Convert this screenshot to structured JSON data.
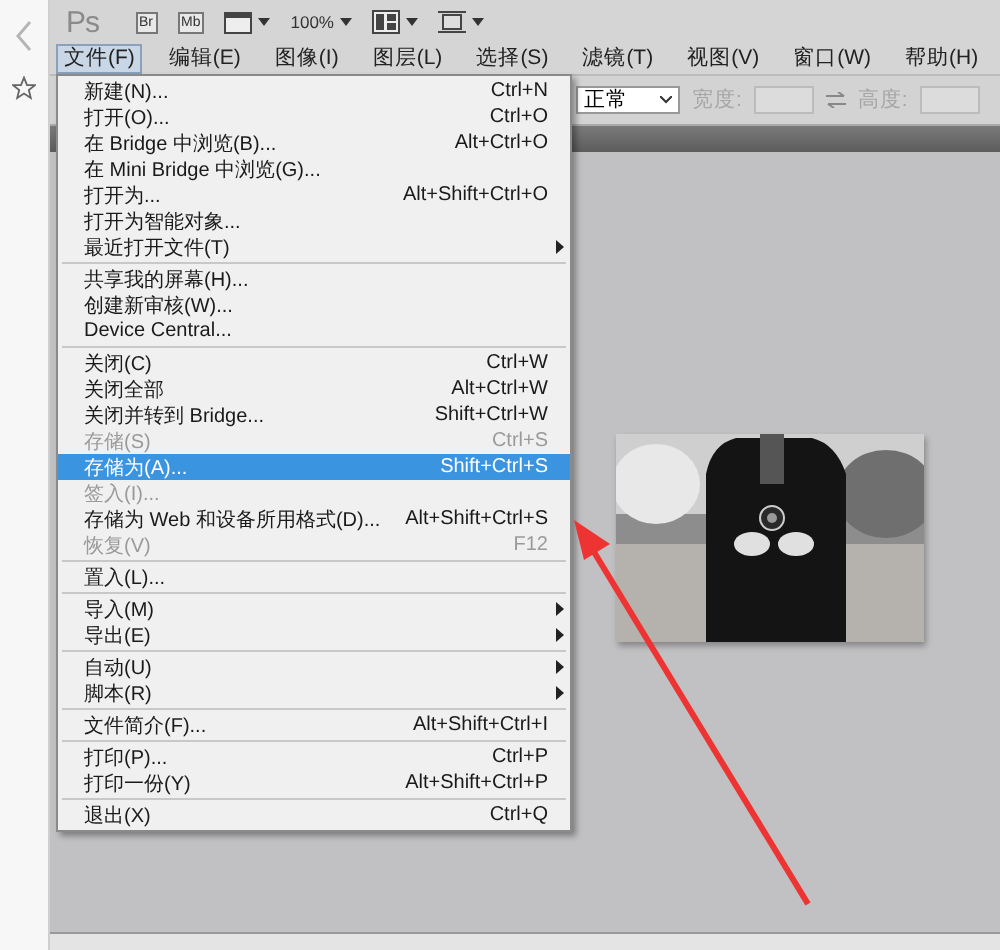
{
  "toolbar": {
    "logo": "Ps",
    "bridge": "Br",
    "mini_bridge": "Mb",
    "zoom": "100%"
  },
  "menubar": [
    {
      "label": "文件(F)",
      "selected": true
    },
    {
      "label": "编辑(E)",
      "selected": false
    },
    {
      "label": "图像(I)",
      "selected": false
    },
    {
      "label": "图层(L)",
      "selected": false
    },
    {
      "label": "选择(S)",
      "selected": false
    },
    {
      "label": "滤镜(T)",
      "selected": false
    },
    {
      "label": "视图(V)",
      "selected": false
    },
    {
      "label": "窗口(W)",
      "selected": false
    },
    {
      "label": "帮助(H)",
      "selected": false
    }
  ],
  "file_menu": {
    "items": [
      {
        "kind": "item",
        "label": "新建(N)...",
        "shortcut": "Ctrl+N",
        "disabled": false,
        "selected": false,
        "submenu": false
      },
      {
        "kind": "item",
        "label": "打开(O)...",
        "shortcut": "Ctrl+O",
        "disabled": false,
        "selected": false,
        "submenu": false
      },
      {
        "kind": "item",
        "label": "在 Bridge 中浏览(B)...",
        "shortcut": "Alt+Ctrl+O",
        "disabled": false,
        "selected": false,
        "submenu": false
      },
      {
        "kind": "item",
        "label": "在 Mini Bridge 中浏览(G)...",
        "disabled": false,
        "selected": false,
        "submenu": false
      },
      {
        "kind": "item",
        "label": "打开为...",
        "shortcut": "Alt+Shift+Ctrl+O",
        "disabled": false,
        "selected": false,
        "submenu": false
      },
      {
        "kind": "item",
        "label": "打开为智能对象...",
        "disabled": false,
        "selected": false,
        "submenu": false
      },
      {
        "kind": "item",
        "label": "最近打开文件(T)",
        "disabled": false,
        "selected": false,
        "submenu": true
      },
      {
        "kind": "separator"
      },
      {
        "kind": "item",
        "label": "共享我的屏幕(H)...",
        "disabled": false,
        "selected": false,
        "submenu": false
      },
      {
        "kind": "item",
        "label": "创建新审核(W)...",
        "disabled": false,
        "selected": false,
        "submenu": false
      },
      {
        "kind": "item",
        "label": "Device Central...",
        "disabled": false,
        "selected": false,
        "submenu": false
      },
      {
        "kind": "separator"
      },
      {
        "kind": "item",
        "label": "关闭(C)",
        "shortcut": "Ctrl+W",
        "disabled": false,
        "selected": false,
        "submenu": false
      },
      {
        "kind": "item",
        "label": "关闭全部",
        "shortcut": "Alt+Ctrl+W",
        "disabled": false,
        "selected": false,
        "submenu": false
      },
      {
        "kind": "item",
        "label": "关闭并转到 Bridge...",
        "shortcut": "Shift+Ctrl+W",
        "disabled": false,
        "selected": false,
        "submenu": false
      },
      {
        "kind": "item",
        "label": "存储(S)",
        "shortcut": "Ctrl+S",
        "disabled": true,
        "selected": false,
        "submenu": false
      },
      {
        "kind": "item",
        "label": "存储为(A)...",
        "shortcut": "Shift+Ctrl+S",
        "disabled": false,
        "selected": true,
        "submenu": false
      },
      {
        "kind": "item",
        "label": "签入(I)...",
        "disabled": true,
        "selected": false,
        "submenu": false
      },
      {
        "kind": "item",
        "label": "存储为 Web 和设备所用格式(D)...",
        "shortcut": "Alt+Shift+Ctrl+S",
        "disabled": false,
        "selected": false,
        "submenu": false
      },
      {
        "kind": "item",
        "label": "恢复(V)",
        "shortcut": "F12",
        "disabled": true,
        "selected": false,
        "submenu": false
      },
      {
        "kind": "separator"
      },
      {
        "kind": "item",
        "label": "置入(L)...",
        "disabled": false,
        "selected": false,
        "submenu": false
      },
      {
        "kind": "separator"
      },
      {
        "kind": "item",
        "label": "导入(M)",
        "disabled": false,
        "selected": false,
        "submenu": true
      },
      {
        "kind": "item",
        "label": "导出(E)",
        "disabled": false,
        "selected": false,
        "submenu": true
      },
      {
        "kind": "separator"
      },
      {
        "kind": "item",
        "label": "自动(U)",
        "disabled": false,
        "selected": false,
        "submenu": true
      },
      {
        "kind": "item",
        "label": "脚本(R)",
        "disabled": false,
        "selected": false,
        "submenu": true
      },
      {
        "kind": "separator"
      },
      {
        "kind": "item",
        "label": "文件简介(F)...",
        "shortcut": "Alt+Shift+Ctrl+I",
        "disabled": false,
        "selected": false,
        "submenu": false
      },
      {
        "kind": "separator"
      },
      {
        "kind": "item",
        "label": "打印(P)...",
        "shortcut": "Ctrl+P",
        "disabled": false,
        "selected": false,
        "submenu": false
      },
      {
        "kind": "item",
        "label": "打印一份(Y)",
        "shortcut": "Alt+Shift+Ctrl+P",
        "disabled": false,
        "selected": false,
        "submenu": false
      },
      {
        "kind": "separator"
      },
      {
        "kind": "item",
        "label": "退出(X)",
        "shortcut": "Ctrl+Q",
        "disabled": false,
        "selected": false,
        "submenu": false
      }
    ]
  },
  "options_bar": {
    "mode": "正常",
    "width_label": "宽度:",
    "height_label": "高度:",
    "disabled": true
  }
}
